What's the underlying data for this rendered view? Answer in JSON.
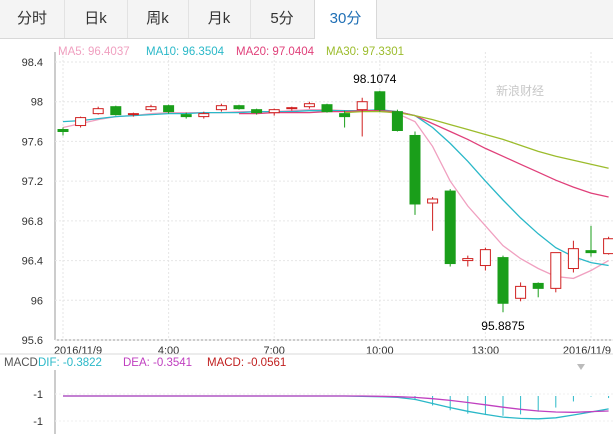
{
  "tabs": [
    "分时",
    "日k",
    "周k",
    "月k",
    "5分",
    "30分"
  ],
  "active_tab": 5,
  "watermark": "新浪财经",
  "ma_legend": [
    {
      "label": "MA5: 96.4037",
      "color": "#f0a0c0"
    },
    {
      "label": "MA10: 96.3504",
      "color": "#2ab8c8"
    },
    {
      "label": "MA20: 97.0404",
      "color": "#e0407a"
    },
    {
      "label": "MA30: 97.3301",
      "color": "#9cbc2c"
    }
  ],
  "macd_legend": [
    {
      "label": "MACD",
      "color": "#555555"
    },
    {
      "label": "DIF: -0.3822",
      "color": "#2ab8c8"
    },
    {
      "label": "DEA: -0.3541",
      "color": "#c040c0"
    },
    {
      "label": "MACD: -0.0561",
      "color": "#c02020"
    }
  ],
  "chart_data": {
    "type": "candlestick",
    "y_ticks": [
      "98.4",
      "98",
      "97.6",
      "97.2",
      "96.8",
      "96.4",
      "96",
      "95.6"
    ],
    "ylim": [
      95.6,
      98.4
    ],
    "x_labels": [
      "2016/11/9",
      "4:00",
      "7:00",
      "10:00",
      "13:00",
      "2016/11/9"
    ],
    "x_label_index": [
      0,
      6,
      12,
      18,
      24,
      30
    ],
    "high_annotation": "98.1074",
    "low_annotation": "95.8875",
    "high_index": 18,
    "low_index": 25,
    "up_color": "#d02020",
    "down_color": "#1a9e1a",
    "candles": [
      {
        "o": 97.72,
        "h": 97.74,
        "l": 97.66,
        "c": 97.7
      },
      {
        "o": 97.76,
        "h": 97.85,
        "l": 97.74,
        "c": 97.84
      },
      {
        "o": 97.88,
        "h": 97.95,
        "l": 97.87,
        "c": 97.93
      },
      {
        "o": 97.95,
        "h": 97.96,
        "l": 97.86,
        "c": 97.87
      },
      {
        "o": 97.87,
        "h": 97.89,
        "l": 97.85,
        "c": 97.88
      },
      {
        "o": 97.92,
        "h": 97.97,
        "l": 97.9,
        "c": 97.95
      },
      {
        "o": 97.96,
        "h": 97.97,
        "l": 97.88,
        "c": 97.9
      },
      {
        "o": 97.87,
        "h": 97.89,
        "l": 97.83,
        "c": 97.85
      },
      {
        "o": 97.85,
        "h": 97.9,
        "l": 97.83,
        "c": 97.88
      },
      {
        "o": 97.92,
        "h": 97.98,
        "l": 97.9,
        "c": 97.96
      },
      {
        "o": 97.96,
        "h": 97.97,
        "l": 97.92,
        "c": 97.93
      },
      {
        "o": 97.92,
        "h": 97.93,
        "l": 97.87,
        "c": 97.89
      },
      {
        "o": 97.89,
        "h": 97.93,
        "l": 97.86,
        "c": 97.92
      },
      {
        "o": 97.93,
        "h": 97.95,
        "l": 97.91,
        "c": 97.94
      },
      {
        "o": 97.95,
        "h": 98.0,
        "l": 97.93,
        "c": 97.98
      },
      {
        "o": 97.97,
        "h": 97.98,
        "l": 97.89,
        "c": 97.9
      },
      {
        "o": 97.88,
        "h": 97.91,
        "l": 97.74,
        "c": 97.85
      },
      {
        "o": 97.92,
        "h": 98.04,
        "l": 97.65,
        "c": 98.0
      },
      {
        "o": 98.1,
        "h": 98.11,
        "l": 97.9,
        "c": 97.92
      },
      {
        "o": 97.9,
        "h": 97.92,
        "l": 97.7,
        "c": 97.71
      },
      {
        "o": 97.66,
        "h": 97.7,
        "l": 96.86,
        "c": 96.97
      },
      {
        "o": 96.98,
        "h": 97.04,
        "l": 96.7,
        "c": 97.02
      },
      {
        "o": 97.1,
        "h": 97.12,
        "l": 96.34,
        "c": 96.37
      },
      {
        "o": 96.4,
        "h": 96.45,
        "l": 96.34,
        "c": 96.42
      },
      {
        "o": 96.35,
        "h": 96.53,
        "l": 96.3,
        "c": 96.51
      },
      {
        "o": 96.43,
        "h": 96.45,
        "l": 95.88,
        "c": 95.97
      },
      {
        "o": 96.02,
        "h": 96.18,
        "l": 95.99,
        "c": 96.14
      },
      {
        "o": 96.17,
        "h": 96.18,
        "l": 96.03,
        "c": 96.12
      },
      {
        "o": 96.12,
        "h": 96.34,
        "l": 96.08,
        "c": 96.48
      },
      {
        "o": 96.32,
        "h": 96.6,
        "l": 96.28,
        "c": 96.52
      },
      {
        "o": 96.5,
        "h": 96.75,
        "l": 96.44,
        "c": 96.48
      },
      {
        "o": 96.47,
        "h": 96.64,
        "l": 96.46,
        "c": 96.62
      }
    ],
    "ma_lines": {
      "MA5": [
        97.74,
        97.78,
        97.82,
        97.85,
        97.86,
        97.88,
        97.89,
        97.89,
        97.89,
        97.89,
        97.9,
        97.9,
        97.9,
        97.91,
        97.92,
        97.92,
        97.91,
        97.91,
        97.91,
        97.88,
        97.8,
        97.55,
        97.2,
        96.95,
        96.75,
        96.55,
        96.42,
        96.32,
        96.24,
        96.22,
        96.3,
        96.4
      ],
      "MA10": [
        97.8,
        97.81,
        97.83,
        97.85,
        97.86,
        97.87,
        97.88,
        97.88,
        97.89,
        97.89,
        97.89,
        97.9,
        97.9,
        97.9,
        97.91,
        97.91,
        97.91,
        97.91,
        97.92,
        97.9,
        97.86,
        97.74,
        97.58,
        97.4,
        97.2,
        97.01,
        96.83,
        96.67,
        96.53,
        96.44,
        96.38,
        96.35
      ],
      "MA20": [
        null,
        null,
        null,
        null,
        null,
        null,
        null,
        null,
        null,
        null,
        97.88,
        97.88,
        97.89,
        97.89,
        97.89,
        97.9,
        97.9,
        97.91,
        97.91,
        97.9,
        97.86,
        97.78,
        97.7,
        97.62,
        97.53,
        97.45,
        97.37,
        97.29,
        97.21,
        97.14,
        97.08,
        97.04
      ],
      "MA30": [
        null,
        null,
        null,
        null,
        null,
        null,
        null,
        null,
        null,
        null,
        null,
        null,
        null,
        null,
        null,
        null,
        97.89,
        97.9,
        97.9,
        97.89,
        97.86,
        97.82,
        97.77,
        97.72,
        97.67,
        97.62,
        97.56,
        97.5,
        97.45,
        97.41,
        97.37,
        97.33
      ]
    },
    "macd_ticks": [
      "-1",
      "-1"
    ],
    "macd_ylim": [
      -1.6,
      0.4
    ],
    "dif": [
      0.0,
      0.0,
      0.0,
      0.0,
      0.0,
      0.0,
      0.0,
      0.0,
      0.0,
      0.0,
      0.0,
      0.0,
      0.0,
      0.0,
      0.0,
      0.0,
      0.0,
      -0.01,
      -0.02,
      -0.04,
      -0.1,
      -0.22,
      -0.34,
      -0.45,
      -0.54,
      -0.62,
      -0.66,
      -0.67,
      -0.64,
      -0.56,
      -0.47,
      -0.38
    ],
    "dea": [
      0.0,
      0.0,
      0.0,
      0.0,
      0.0,
      0.0,
      0.0,
      0.0,
      0.0,
      0.0,
      0.0,
      0.0,
      0.0,
      0.0,
      0.0,
      0.0,
      0.0,
      0.0,
      -0.01,
      -0.02,
      -0.04,
      -0.08,
      -0.13,
      -0.19,
      -0.26,
      -0.33,
      -0.39,
      -0.44,
      -0.47,
      -0.48,
      -0.46,
      -0.44
    ],
    "macd_hist": [
      0,
      0,
      0,
      0,
      0,
      0,
      0,
      0,
      0,
      0,
      0,
      0,
      0,
      0,
      0,
      0,
      0,
      0,
      0,
      0,
      -0.12,
      -0.28,
      -0.42,
      -0.52,
      -0.56,
      -0.58,
      -0.54,
      -0.46,
      -0.34,
      -0.16,
      -0.02,
      -0.06
    ]
  }
}
